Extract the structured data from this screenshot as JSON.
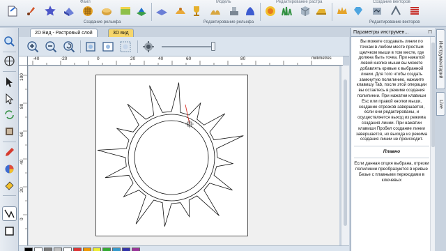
{
  "ribbon": {
    "groups": [
      {
        "label": "Файл"
      },
      {
        "label": "Модель"
      },
      {
        "label": "Редактирование растра"
      },
      {
        "label": "Создание векторов"
      }
    ],
    "bottom_groups": [
      {
        "label": "Создание рельефа"
      },
      {
        "label": "Редактирование рельефа"
      },
      {
        "label": "Редактирование векторов"
      }
    ]
  },
  "tabs": [
    {
      "label": "2D Вид - Растровый слой"
    },
    {
      "label": "3D вид"
    }
  ],
  "ruler": {
    "unit": "millimetres",
    "top_ticks": [
      "-40",
      "-20",
      "0",
      "20",
      "40",
      "60",
      "80"
    ],
    "left_ticks": [
      "100",
      "80",
      "60",
      "40",
      "20",
      "0"
    ]
  },
  "panel": {
    "title": "Параметры инструмен...",
    "help_main": "Вы можете создавать линии по точкам в любом месте простым щелчком мыши в том месте, где должна быть точка. При нажатой левой кнопке мыши вы можете добавлять кривые к выбранной линии. Для того чтобы создать замкнутую полилинию, нажмите клавишу Tab, после этой операции вы остаетесь в режиме создания полилинии. При нажатии клавиши Esc или правой кнопки мыши, создание отрезков завершается, если они редактированы, и осуществляется выход из режима создания линии. При нажатии клавиши Пробел создание линии завершается, но выхода из режима создания линии не происходит.",
    "section_title": "Плавно",
    "section_text": "Если данная опция выбрана, отрезки полилинии преобразуются в кривые Безье с плавными переходами в ключевых"
  },
  "side_tabs": [
    {
      "label": "Инструментарий"
    },
    {
      "label": "Live"
    }
  ],
  "colors": {
    "accent_tab": "#f6d66b",
    "selection": "#d9342b"
  }
}
